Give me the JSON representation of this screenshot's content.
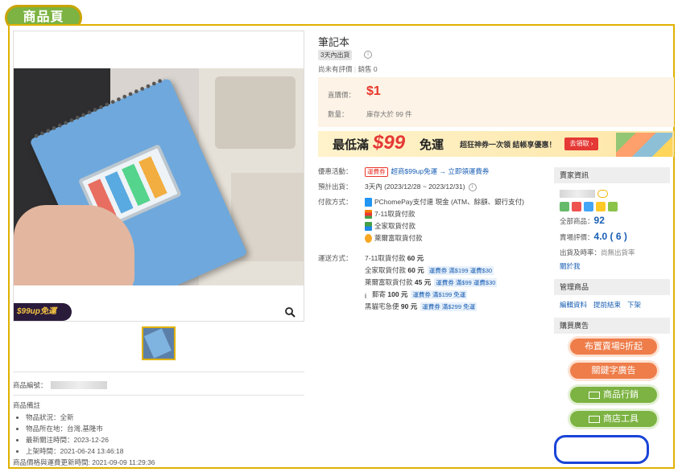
{
  "page_badge": "商品頁",
  "product": {
    "title": "筆記本",
    "ship_tag": "3天內出貨",
    "rating_text": "尚未有評價",
    "sales_label": "銷售",
    "sales_count": "0",
    "price_label": "直購價：",
    "price": "$1",
    "qty_label": "數量：",
    "stock_text": "庫存大於 99 件",
    "image_promo": "$99up免運",
    "id_label": "商品編號：",
    "note_label": "商品備註",
    "notes": [
      "物品狀況：全新",
      "物品所在地：台灣,基隆市",
      "最新關注時間：2023-12-26",
      "上架時間：2021-06-24 13:46:18"
    ],
    "updated_text": "商品價格與運費更新時間: 2021-09-09 11:29:36"
  },
  "banner": {
    "text1": "最低滿",
    "amount": "$99",
    "text2": "免運",
    "sub": "超狂神券一次領 結帳享優惠！",
    "cta": "去領取 ›"
  },
  "details": {
    "promo_label": "優惠活動：",
    "promo_tag": "運費券",
    "promo_link": "超商$99up免運 → 立即領運費券",
    "ship_label": "預計出貨：",
    "ship_value": "3天內 (2023/12/28 ~ 2023/12/31)",
    "pay_label": "付款方式：",
    "pay_methods": [
      "PChomePay支付連 現金 (ATM、餘額、銀行支付)",
      "7-11取貨付款",
      "全家取貨付款",
      "萊爾富取貨付款"
    ],
    "deliv_label": "運送方式：",
    "delivery": [
      {
        "name": "7-11取貨付款",
        "price": "60 元",
        "tag": ""
      },
      {
        "name": "全家取貨付款",
        "price": "60 元",
        "tag": "運費券 滿$199 運費$30"
      },
      {
        "name": "萊爾富取貨付款",
        "price": "45 元",
        "tag": "運費券 滿$99 運費$30"
      },
      {
        "name": "郵寄",
        "price": "100 元",
        "tag": "運費券 滿$199 免運"
      },
      {
        "name": "黑貓宅急便",
        "price": "90 元",
        "tag": "運費券 滿$299 免運"
      }
    ]
  },
  "seller": {
    "header": "賣家資訊",
    "total_label": "全部商品：",
    "total_value": "92",
    "rating_label": "賣場評價：",
    "rating_value": "4.0 ( 6 )",
    "ship_rate_label": "出貨及時率：",
    "ship_rate_value": "尚無出貨率",
    "about_link": "關於我"
  },
  "manage": {
    "header": "管理商品",
    "links": [
      "編輯資料",
      "提前結束",
      "下架"
    ]
  },
  "ads": {
    "header": "購買廣告",
    "buttons": [
      "布置賣場5折起",
      "關鍵字廣告",
      "商品行銷",
      "商店工具"
    ]
  },
  "colors": {
    "accent": "#e8372b",
    "brand_green": "#7cb342",
    "highlight_border": "#e0b100",
    "link": "#1a5fb4"
  }
}
